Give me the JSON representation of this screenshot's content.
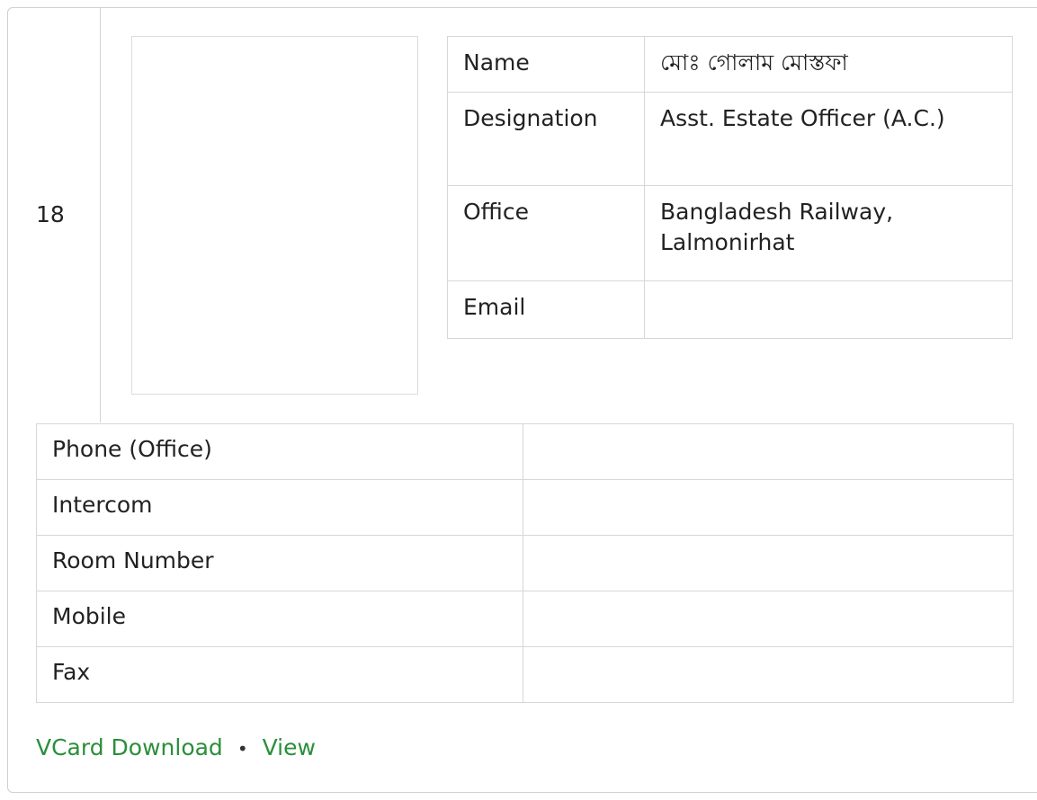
{
  "serial": "18",
  "info": {
    "rows": [
      {
        "label": "Name",
        "value": "মোঃ গোলাম মোস্তফা"
      },
      {
        "label": "Designation",
        "value": "Asst. Estate Officer (A.C.)"
      },
      {
        "label": "Office",
        "value": "Bangladesh Railway, Lalmonirhat"
      },
      {
        "label": "Email",
        "value": ""
      }
    ]
  },
  "contact": {
    "rows": [
      {
        "label": "Phone (Office)",
        "value": ""
      },
      {
        "label": "Intercom",
        "value": ""
      },
      {
        "label": "Room Number",
        "value": ""
      },
      {
        "label": "Mobile",
        "value": ""
      },
      {
        "label": "Fax",
        "value": ""
      }
    ]
  },
  "links": {
    "vcard_label": "VCard Download",
    "separator": "•",
    "view_label": "View"
  },
  "colors": {
    "link": "#2a8f3b",
    "border": "#d7d7d7"
  }
}
